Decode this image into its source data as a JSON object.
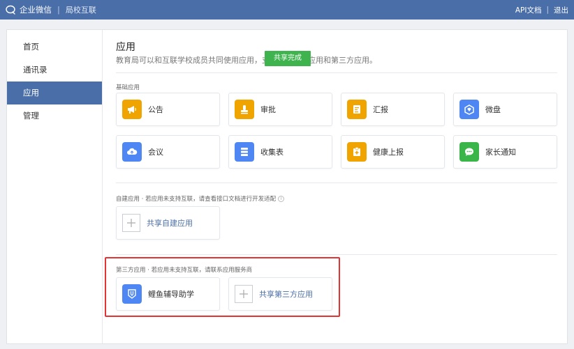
{
  "topbar": {
    "brand": "企业微信",
    "subtitle": "局校互联",
    "links": [
      "API文档",
      "退出"
    ],
    "bg_color": "#4a6ea8"
  },
  "sidebar": {
    "items": [
      {
        "label": "首页"
      },
      {
        "label": "通讯录"
      },
      {
        "label": "应用",
        "active": true
      },
      {
        "label": "管理"
      }
    ]
  },
  "main": {
    "title": "应用",
    "desc_before": "教育局可以和互联学校成员共同使用应用，支",
    "desc_after": "建应用和第三方应用。",
    "toast": "共享完成",
    "basic": {
      "label": "基础应用",
      "apps": [
        {
          "label": "公告",
          "icon": "megaphone-icon",
          "color": "#f0a400"
        },
        {
          "label": "审批",
          "icon": "stamp-icon",
          "color": "#f0a400"
        },
        {
          "label": "汇报",
          "icon": "report-icon",
          "color": "#f0a400"
        },
        {
          "label": "微盘",
          "icon": "drive-icon",
          "color": "#4e87f4"
        },
        {
          "label": "会议",
          "icon": "cloud-icon",
          "color": "#4e87f4"
        },
        {
          "label": "收集表",
          "icon": "form-stack-icon",
          "color": "#4e87f4"
        },
        {
          "label": "健康上报",
          "icon": "health-report-icon",
          "color": "#f0a400"
        },
        {
          "label": "家长通知",
          "icon": "chat-bubble-icon",
          "color": "#39b54a"
        }
      ]
    },
    "custom": {
      "label": "自建应用 · 若应用未支持互联，请查看接口文档进行开发适配",
      "add_label": "共享自建应用"
    },
    "third_party": {
      "label": "第三方应用 · 若应用未支持互联，请联系应用服务商",
      "apps": [
        {
          "label": "鲤鱼辅导助学",
          "icon": "pencil-shield-icon",
          "color": "#4e87f4"
        }
      ],
      "add_label": "共享第三方应用"
    },
    "highlight_color": "#e53333"
  }
}
